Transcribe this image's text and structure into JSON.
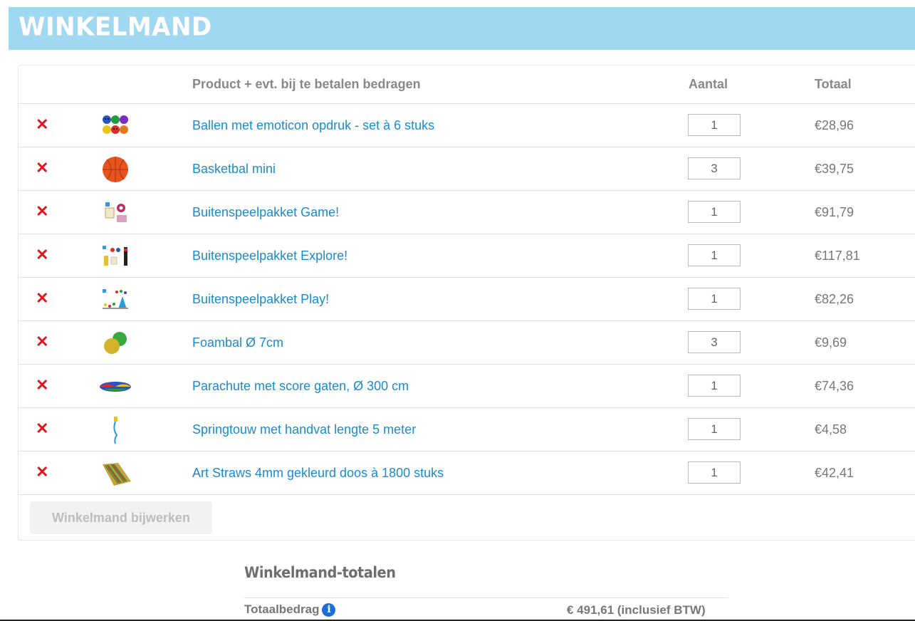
{
  "header": {
    "title": "WINKELMAND"
  },
  "table": {
    "col_product": "Product + evt. bij te betalen bedragen",
    "col_qty": "Aantal",
    "col_total": "Totaal"
  },
  "items": [
    {
      "name": "Ballen met emoticon opdruk - set à 6 stuks",
      "qty": "1",
      "total": "€28,96",
      "thumb": "emoticon-balls-icon"
    },
    {
      "name": "Basketbal mini",
      "qty": "3",
      "total": "€39,75",
      "thumb": "basketball-icon"
    },
    {
      "name": "Buitenspeelpakket Game!",
      "qty": "1",
      "total": "€91,79",
      "thumb": "game-pack-icon"
    },
    {
      "name": "Buitenspeelpakket Explore!",
      "qty": "1",
      "total": "€117,81",
      "thumb": "explore-pack-icon"
    },
    {
      "name": "Buitenspeelpakket Play!",
      "qty": "1",
      "total": "€82,26",
      "thumb": "play-pack-icon"
    },
    {
      "name": "Foambal Ø 7cm",
      "qty": "3",
      "total": "€9,69",
      "thumb": "foam-balls-icon"
    },
    {
      "name": "Parachute met score gaten, Ø 300 cm",
      "qty": "1",
      "total": "€74,36",
      "thumb": "parachute-icon"
    },
    {
      "name": "Springtouw met handvat lengte 5 meter",
      "qty": "1",
      "total": "€4,58",
      "thumb": "jump-rope-icon"
    },
    {
      "name": "Art Straws 4mm gekleurd doos à 1800 stuks",
      "qty": "1",
      "total": "€42,41",
      "thumb": "art-straws-icon"
    }
  ],
  "update_label": "Winkelmand bijwerken",
  "totals": {
    "title": "Winkelmand-totalen",
    "label": "Totaalbedrag",
    "value": "€ 491,61 (inclusief BTW)"
  },
  "colors": {
    "header_band": "#a0d8f2",
    "link": "#1a8bd1",
    "remove": "#e0161d"
  }
}
